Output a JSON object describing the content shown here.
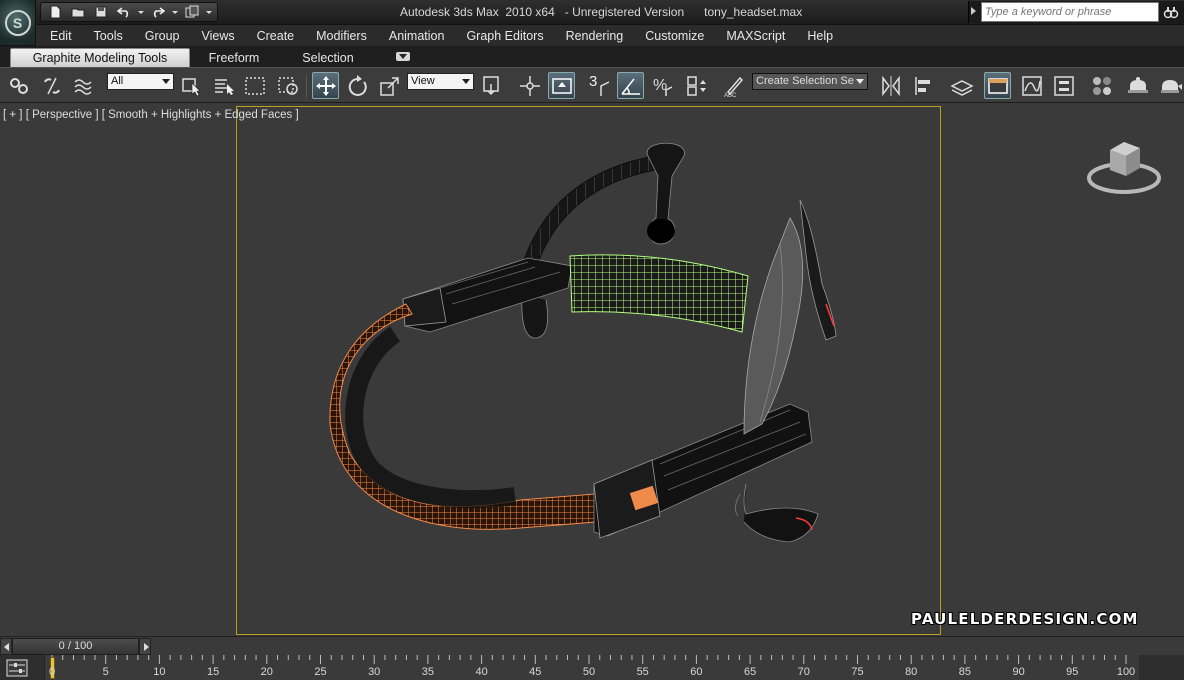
{
  "titlebar": {
    "title": "Autodesk 3ds Max  2010 x64   - Unregistered Version      tony_headset.max",
    "app_button_glyph": "S",
    "search_placeholder": "Type a keyword or phrase"
  },
  "menubar": {
    "items": [
      "Edit",
      "Tools",
      "Group",
      "Views",
      "Create",
      "Modifiers",
      "Animation",
      "Graph Editors",
      "Rendering",
      "Customize",
      "MAXScript",
      "Help"
    ]
  },
  "ribbon": {
    "tabs": [
      "Graphite Modeling Tools",
      "Freeform",
      "Selection"
    ]
  },
  "toolbar": {
    "selection_filter": "All",
    "reference_coord": "View",
    "snap_label": "3",
    "named_selection_placeholder": "Create Selection Se"
  },
  "viewport": {
    "label": "[ + ] [ Perspective ] [ Smooth + Highlights + Edged Faces ]",
    "watermark": "PAULELDERDESIGN.COM",
    "viewcube_icon": "viewcube-icon",
    "colors": {
      "safe_frame": "#b4a21c",
      "selected_wire_orange": "#f08a4b",
      "selected_wire_green": "#b5ff82",
      "object_dark": "#141414",
      "edges": "#8a8a8a"
    }
  },
  "timeslider": {
    "position_label": "0 / 100",
    "ticks": [
      "0",
      "5",
      "10",
      "15",
      "20",
      "25",
      "30",
      "35",
      "40",
      "45",
      "50",
      "55",
      "60",
      "65",
      "70",
      "75",
      "80",
      "85",
      "90",
      "95",
      "100"
    ]
  }
}
